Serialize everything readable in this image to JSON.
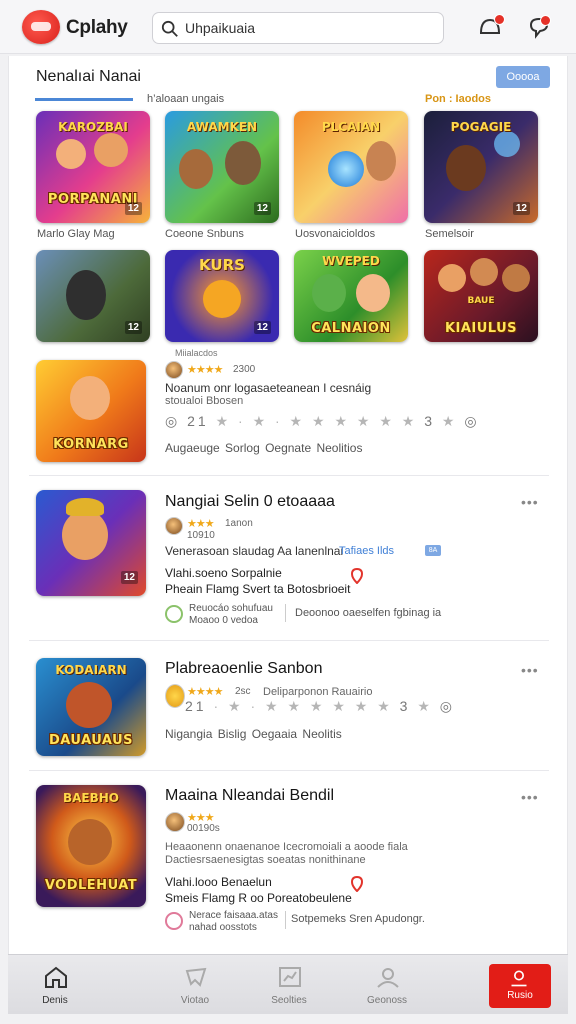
{
  "header": {
    "brand": "Cplahy",
    "search_value": "Uhpaikuaia",
    "search_placeholder": "Uhpaikuaia",
    "icons": [
      "search-icon",
      "chat-icon",
      "notification-icon"
    ]
  },
  "section": {
    "title": "Nenalıai Nanai",
    "button_label": "Ooooa",
    "tab_left": "h’aloaan ungais",
    "tab_right": "Pon : Iaodos"
  },
  "grid": [
    {
      "art_title": "PORPANANI",
      "art_top": "KAROZBAI",
      "num": "12",
      "caption": "Marlo Glay Mag"
    },
    {
      "art_title": "",
      "art_top": "AWAMKEN",
      "num": "12",
      "caption": "Coeone Snbuns"
    },
    {
      "art_title": "",
      "art_top": "PLCAIAN",
      "num": "",
      "caption": "Uosvonaicioldos"
    },
    {
      "art_title": "",
      "art_top": "POGAGIE",
      "num": "12",
      "caption": "Semelsoir"
    },
    {
      "art_title": "",
      "art_top": "",
      "num": "12",
      "caption": ""
    },
    {
      "art_title": "KURS",
      "art_top": "",
      "num": "12",
      "caption": ""
    },
    {
      "art_title": "CALNAION",
      "art_top": "WVEPED",
      "num": "",
      "caption": ""
    },
    {
      "art_title": "KIAIULUS",
      "art_top": "BAUE",
      "num": "",
      "caption": ""
    }
  ],
  "featured": {
    "art_title": "KORNARG",
    "label": "Miialacdos",
    "stars_text": "2300",
    "desc1": "Noanum onr logasaeteanean I cesnáig",
    "desc2": "stoualoi Bbosen",
    "rating_prefix": "21",
    "rating_mid": "3",
    "links": "Augaeuge   Sorlog   Oegnate   Neolitios"
  },
  "rows": [
    {
      "title": "Nangiai Selin 0 etoaaaa",
      "stars_text": "1anon",
      "sub": "10910",
      "desc": "Venerasoan slaudag Aa lanenlnai",
      "link": "Tafiaes Ilds",
      "tag": "8A",
      "feat1": "Vlahi.soeno Sorpalnie",
      "feat2": "Pheain Flamg Svert ta Botosbrioeit",
      "note1": "Reuocáo sohufuau",
      "note2": "Moaoo 0 vedoa",
      "note_right": "Deoonoo oaeselfen fgbinag ia",
      "more": "•••"
    },
    {
      "title": "Plabreaoenlie Sanbon",
      "stars_text": "2sc",
      "sub": "Deliparponon Rauairio",
      "rating_prefix": "21",
      "rating_mid": "3",
      "links": "Nigangia   Bislig   Oegaaia   Neolitis",
      "more": "•••"
    },
    {
      "title": "Maaina Nleandai Bendil",
      "stars_text": "",
      "sub": "00190s",
      "desc1": "Heaaonenn onaenanoe Icecromoiali a aoode fiala",
      "desc2": "Dactiesrsaenesigtas soeatas nonithinane",
      "feat1": "Vlahi.looo Benaelun",
      "feat2": "Smeis Flamg R oo Poreatobeulene",
      "note1": "Nerace faisaaa.atas",
      "note2": "nahad oosstots",
      "note_right": "Sotpemeks Sren Apudongr.",
      "more": "•••"
    }
  ],
  "nav": [
    {
      "label": "Denis",
      "icon": "home-icon"
    },
    {
      "label": "Viotao",
      "icon": "heart-icon"
    },
    {
      "label": "Seolties",
      "icon": "chart-icon"
    },
    {
      "label": "Geonoss",
      "icon": "profile-icon"
    },
    {
      "label": "Rusio",
      "icon": "user-icon"
    }
  ],
  "colors": {
    "accent": "#e21d17",
    "link": "#3f7fd6",
    "star": "#f0a81a",
    "button": "#7ea8e3"
  }
}
